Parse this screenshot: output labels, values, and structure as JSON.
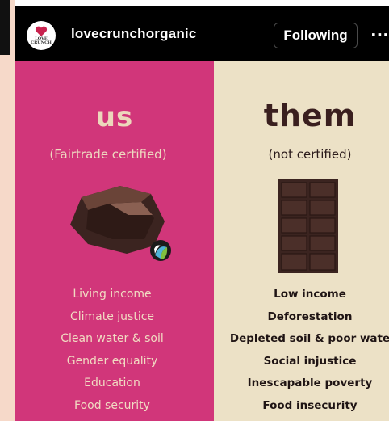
{
  "header": {
    "username": "lovecrunchorganic",
    "follow_label": "Following",
    "more_label": "···",
    "avatar_text": "LOVE CRUNCH",
    "avatar_icon": "heart-icon"
  },
  "left": {
    "title": "us",
    "subtitle": "(Fairtrade certified)",
    "items": [
      "Living income",
      "Climate justice",
      "Clean water & soil",
      "Gender equality",
      "Education",
      "Food security"
    ]
  },
  "right": {
    "title": "them",
    "subtitle": "(not certified)",
    "items": [
      "Low income",
      "Deforestation",
      "Depleted soil & poor wate",
      "Social injustice",
      "Inescapable poverty",
      "Food insecurity"
    ]
  },
  "colors": {
    "header_bg": "#000000",
    "left_panel": "#d1367a",
    "right_panel": "#ece1c6",
    "chocolate": "#3b2420",
    "left_text": "#ecd7bc",
    "right_title": "#3a1f1f"
  }
}
